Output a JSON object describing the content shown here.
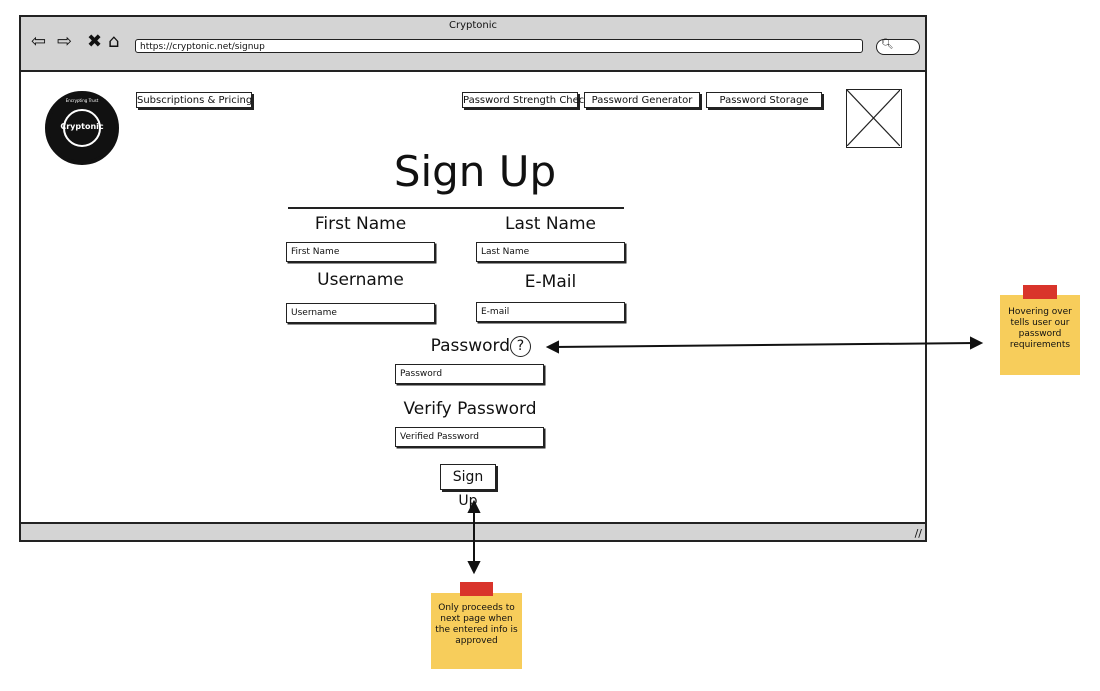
{
  "window": {
    "title": "Cryptonic",
    "url": "https://cryptonic.net/signup"
  },
  "logo": {
    "brand": "Cryptonic",
    "tagline": "Encrypting Trust"
  },
  "nav": {
    "subscriptions": "Subscriptions & Pricing",
    "strength_check": "Password Strength Check",
    "generator": "Password Generator",
    "storage": "Password Storage"
  },
  "form": {
    "title": "Sign Up",
    "first_name": {
      "label": "First Name",
      "placeholder": "First Name"
    },
    "last_name": {
      "label": "Last Name",
      "placeholder": "Last Name"
    },
    "username": {
      "label": "Username",
      "placeholder": "Username"
    },
    "email": {
      "label": "E-Mail",
      "placeholder": "E-mail"
    },
    "password": {
      "label": "Password",
      "placeholder": "Password"
    },
    "verify_password": {
      "label": "Verify Password",
      "placeholder": "Verified Password"
    },
    "help_glyph": "?",
    "submit": "Sign Up"
  },
  "notes": {
    "password_help": "Hovering over tells user our password requirements",
    "signup": "Only proceeds to next page when the entered info is approved"
  },
  "icons": [
    "back-arrow-icon",
    "forward-arrow-icon",
    "close-icon",
    "home-icon",
    "search-icon",
    "help-icon",
    "resize-grip-icon",
    "image-placeholder-icon"
  ],
  "colors": {
    "chrome": "#d4d4d4",
    "sticky": "#f7cd5b",
    "tape": "#d9342b"
  }
}
